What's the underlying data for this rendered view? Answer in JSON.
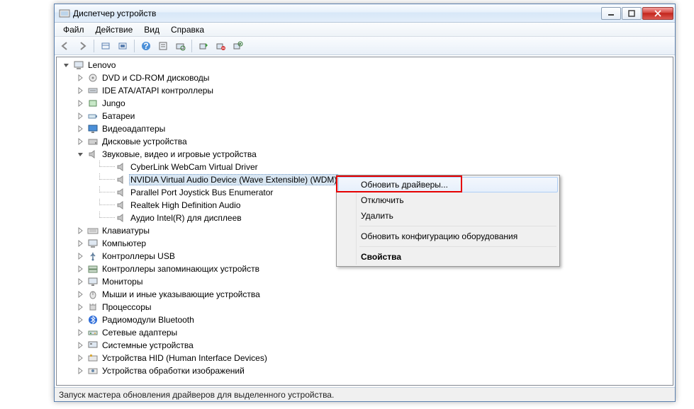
{
  "window": {
    "title": "Диспетчер устройств"
  },
  "menu": {
    "file": "Файл",
    "action": "Действие",
    "view": "Вид",
    "help": "Справка"
  },
  "tree": {
    "root": "Lenovo",
    "items": [
      {
        "label": "DVD и CD-ROM дисководы"
      },
      {
        "label": "IDE ATA/ATAPI контроллеры"
      },
      {
        "label": "Jungo"
      },
      {
        "label": "Батареи"
      },
      {
        "label": "Видеоадаптеры"
      },
      {
        "label": "Дисковые устройства"
      },
      {
        "label": "Звуковые, видео и игровые устройства",
        "expanded": true,
        "children": [
          "CyberLink WebCam Virtual Driver",
          "NVIDIA Virtual Audio Device (Wave Extensible) (WDM)",
          "Parallel Port Joystick Bus Enumerator",
          "Realtek High Definition Audio",
          "Аудио Intel(R) для дисплеев"
        ],
        "selected_child": 1
      },
      {
        "label": "Клавиатуры"
      },
      {
        "label": "Компьютер"
      },
      {
        "label": "Контроллеры USB"
      },
      {
        "label": "Контроллеры запоминающих устройств"
      },
      {
        "label": "Мониторы"
      },
      {
        "label": "Мыши и иные указывающие устройства"
      },
      {
        "label": "Процессоры"
      },
      {
        "label": "Радиомодули Bluetooth"
      },
      {
        "label": "Сетевые адаптеры"
      },
      {
        "label": "Системные устройства"
      },
      {
        "label": "Устройства HID (Human Interface Devices)"
      },
      {
        "label": "Устройства обработки изображений"
      }
    ]
  },
  "context_menu": {
    "update": "Обновить драйверы...",
    "disable": "Отключить",
    "delete": "Удалить",
    "rescan": "Обновить конфигурацию оборудования",
    "properties": "Свойства"
  },
  "status": "Запуск мастера обновления драйверов для выделенного устройства."
}
